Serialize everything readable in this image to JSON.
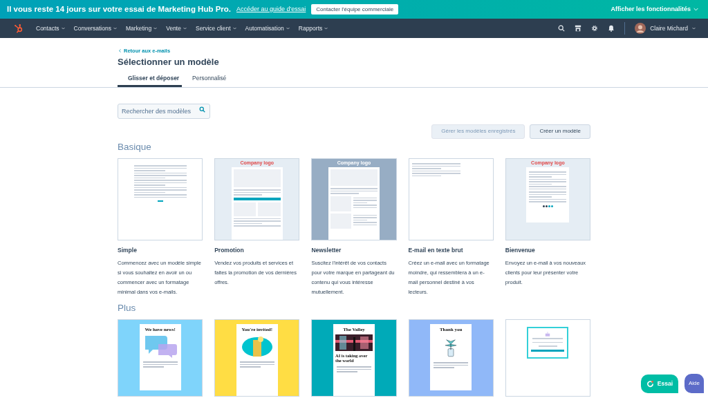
{
  "trial_banner": {
    "message": "Il vous reste 14 jours sur votre essai de Marketing Hub Pro.",
    "link": "Accéder au guide d'essai",
    "button": "Contacter l'équipe commerciale",
    "features": "Afficher les fonctionnalités"
  },
  "nav": {
    "items": [
      "Contacts",
      "Conversations",
      "Marketing",
      "Vente",
      "Service client",
      "Automatisation",
      "Rapports"
    ],
    "user": "Claire Michard"
  },
  "back_link": "Retour aux e-mails",
  "title": "Sélectionner un modèle",
  "tabs": [
    {
      "label": "Glisser et déposer",
      "selected": true
    },
    {
      "label": "Personnalisé",
      "selected": false
    }
  ],
  "search": {
    "placeholder": "Rechercher des modèles"
  },
  "actions": [
    {
      "label": "Gérer les modèles enregistrés",
      "disabled": true
    },
    {
      "label": "Créer un modèle",
      "disabled": false
    }
  ],
  "sections": [
    {
      "heading": "Basique",
      "templates": [
        {
          "thumb": {
            "kind": "plain"
          },
          "name": "Simple",
          "description": "Commencez avec un modèle simple si vous souhaitez en avoir un ou commencer avec un formatage minimal dans vos e-mails."
        },
        {
          "thumb": {
            "kind": "promo",
            "logo": "Company logo"
          },
          "name": "Promotion",
          "description": "Vendez vos produits et services et faites la promotion de vos dernières offres."
        },
        {
          "thumb": {
            "kind": "newsletter",
            "logo": "Company logo"
          },
          "name": "Newsletter",
          "description": "Suscitez l'intérêt de vos contacts pour votre marque en partageant du contenu qui vous intéresse mutuellement."
        },
        {
          "thumb": {
            "kind": "text"
          },
          "name": "E-mail en texte brut",
          "description": "Créez un e-mail avec un formatage moindre, qui ressemblera à un e-mail personnel destiné à vos lecteurs."
        },
        {
          "thumb": {
            "kind": "welcome",
            "logo": "Company logo"
          },
          "name": "Bienvenue",
          "description": "Envoyez un e-mail à vos nouveaux clients pour leur présenter votre produit."
        }
      ]
    },
    {
      "heading": "Plus",
      "templates": [
        {
          "thumb": {
            "kind": "news",
            "headline": "We have news!"
          }
        },
        {
          "thumb": {
            "kind": "invite",
            "headline": "You're invited!"
          }
        },
        {
          "thumb": {
            "kind": "valley",
            "headline": "The Valley",
            "subhead": "AI is taking over the world"
          }
        },
        {
          "thumb": {
            "kind": "thanks",
            "headline": "Thank you"
          }
        },
        {
          "thumb": {
            "kind": "birthday"
          }
        }
      ]
    }
  ],
  "floating": [
    {
      "kind": "trial",
      "label": "Essai"
    },
    {
      "kind": "help",
      "label": "Aide"
    }
  ]
}
